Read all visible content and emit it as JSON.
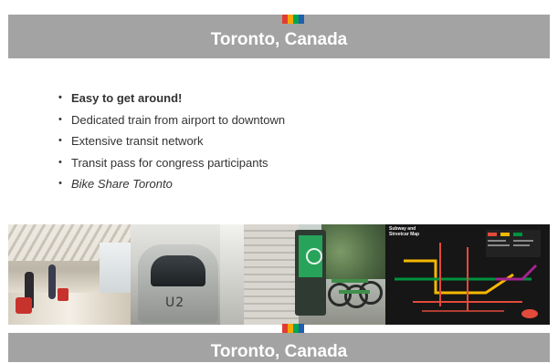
{
  "header": {
    "title": "Toronto, Canada",
    "stripe_colors": [
      "#e03c31",
      "#f5a800",
      "#00a651",
      "#1f5fae"
    ]
  },
  "bullets": [
    {
      "text": "Easy to get around!",
      "style": "bold"
    },
    {
      "text": "Dedicated train from airport to downtown",
      "style": "normal"
    },
    {
      "text": "Extensive transit network",
      "style": "normal"
    },
    {
      "text": "Transit pass for congress participants",
      "style": "normal"
    },
    {
      "text": "Bike Share Toronto",
      "style": "italic"
    }
  ],
  "photos": {
    "train_logo": "U2",
    "map_title_line1": "Subway and",
    "map_title_line2": "Streetcar Map"
  },
  "footer": {
    "title": "Toronto, Canada"
  }
}
